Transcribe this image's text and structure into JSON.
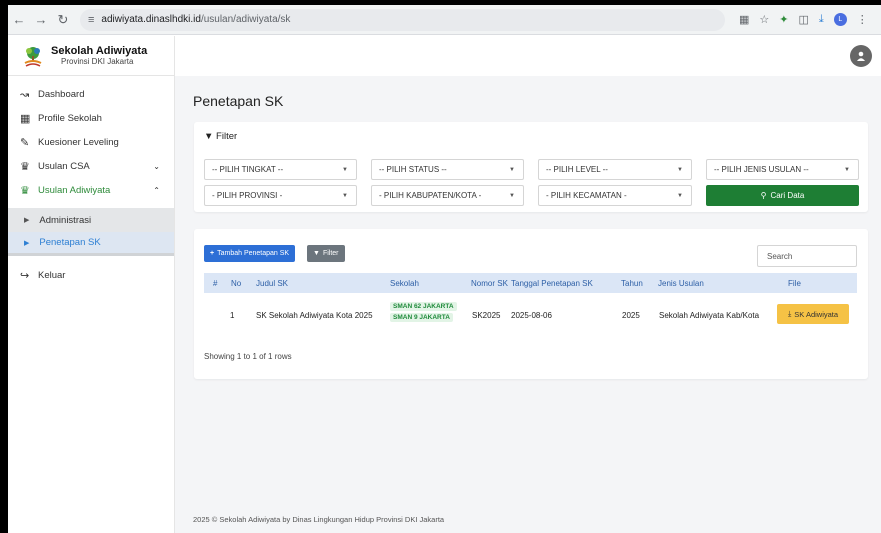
{
  "browser": {
    "url_host": "adiwiyata.dinaslhdki.id",
    "url_path": "/usulan/adiwiyata/sk",
    "profile_letter": "L"
  },
  "brand": {
    "title": "Sekolah Adiwiyata",
    "subtitle": "Provinsi DKI Jakarta"
  },
  "sidebar": {
    "items": [
      {
        "label": "Dashboard",
        "icon": "chart-line-icon"
      },
      {
        "label": "Profile Sekolah",
        "icon": "building-icon"
      },
      {
        "label": "Kuesioner Leveling",
        "icon": "edit-icon"
      },
      {
        "label": "Usulan CSA",
        "icon": "trophy-icon"
      },
      {
        "label": "Usulan Adiwiyata",
        "icon": "trophy-icon"
      }
    ],
    "sub_items": [
      {
        "label": "Administrasi"
      },
      {
        "label": "Penetapan SK"
      }
    ],
    "logout": {
      "label": "Keluar",
      "icon": "sign-out-icon"
    }
  },
  "main": {
    "page_title": "Penetapan SK",
    "filter": {
      "header": "Filter",
      "selects": [
        "-- PILIH TINGKAT --",
        "-- PILIH STATUS --",
        "-- PILIH LEVEL --",
        "-- PILIH JENIS USULAN --",
        "- PILIH PROVINSI -",
        "- PILIH KABUPATEN/KOTA -",
        "- PILIH KECAMATAN -"
      ],
      "search_button": "Cari Data"
    },
    "table": {
      "add_button": "Tambah Penetapan SK",
      "filter_button": "Filter",
      "search_placeholder": "Search",
      "columns": [
        "#",
        "No",
        "Judul SK",
        "Sekolah",
        "Nomor SK",
        "Tanggal Penetapan SK",
        "Tahun",
        "Jenis Usulan",
        "File"
      ],
      "rows": [
        {
          "no": "1",
          "judul": "SK Sekolah Adiwiyata Kota 2025",
          "sekolah": [
            "SMAN 62 JAKARTA",
            "SMAN 9 JAKARTA"
          ],
          "nomor": "SK2025",
          "tanggal": "2025-08-06",
          "tahun": "2025",
          "jenis": "Sekolah Adiwiyata Kab/Kota",
          "file_button": "SK Adiwiyata"
        }
      ],
      "showing": "Showing 1 to 1 of 1 rows"
    },
    "footer": "2025 © Sekolah Adiwiyata by Dinas Lingkungan Hidup Provinsi DKI Jakarta"
  },
  "colors": {
    "active_green": "#2e8b3a",
    "active_blue": "#2d7fd3",
    "cari_button": "#1e7e34",
    "tambah_button": "#2d6fd6",
    "file_button": "#f5c245"
  }
}
